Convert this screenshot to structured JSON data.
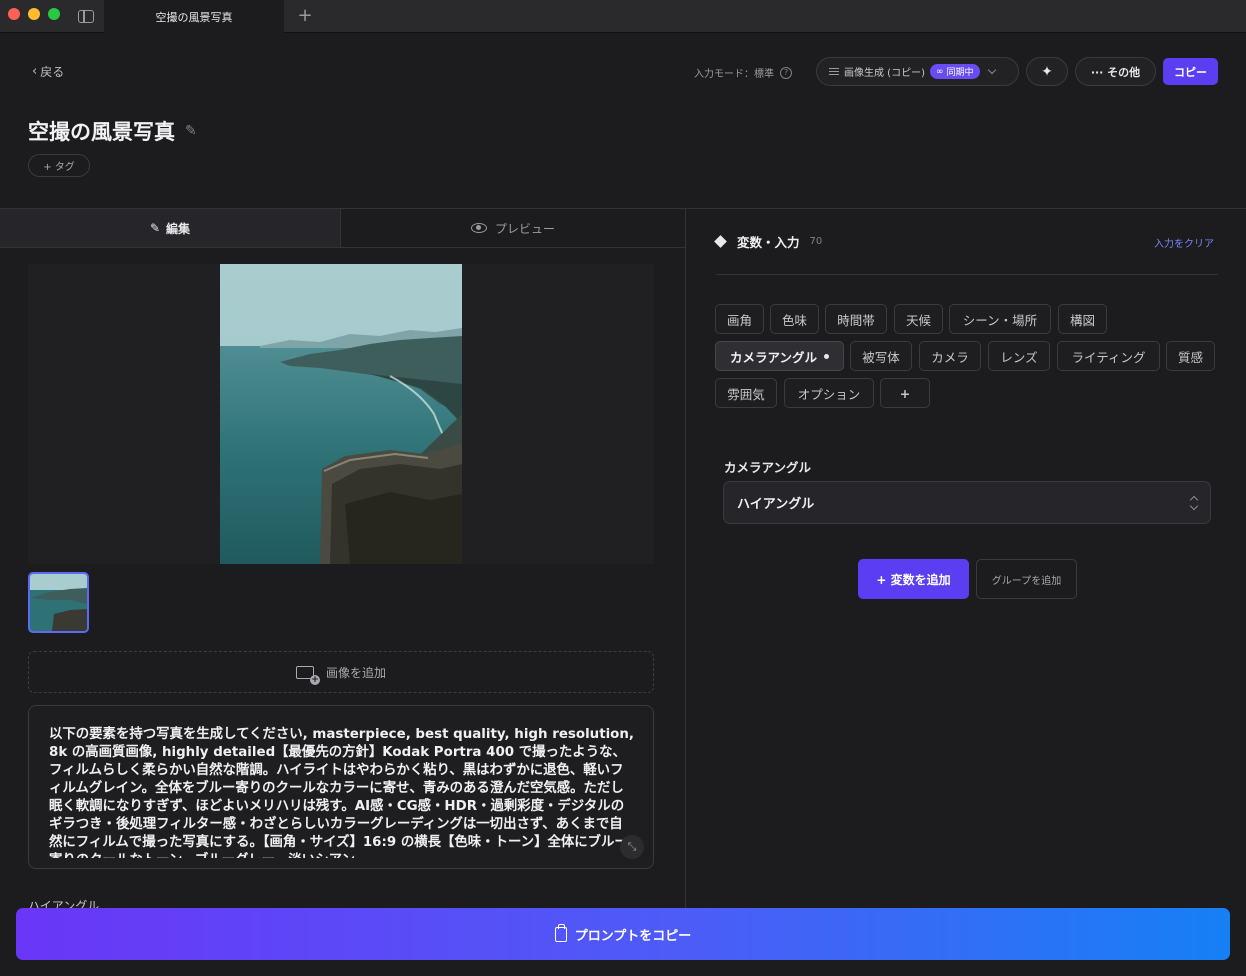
{
  "window": {
    "tab_title": "空撮の風景写真",
    "new_tab_label": "+"
  },
  "header": {
    "back_label": "戻る",
    "input_mode_label": "入力モード：標準",
    "help_symbol": "?",
    "mode_select_label": "画像生成 (コピー)",
    "sync_badge": "同期中",
    "more_label": "··· その他",
    "copy_label": "コピー",
    "page_title": "空撮の風景写真",
    "tag_label": "+ タグ"
  },
  "left_panel": {
    "tabs": [
      {
        "label": "編集"
      },
      {
        "label": "プレビュー"
      }
    ],
    "add_image_label": "画像を追加",
    "prompt_text": "以下の要素を持つ写真を生成してください, masterpiece, best quality, high resolution, 8k の高画質画像, highly detailed【最優先の方針】Kodak Portra 400 で撮ったような、フィルムらしく柔らかい自然な階調。ハイライトはやわらかく粘り、黒はわずかに退色、軽いフィルムグレイン。全体をブルー寄りのクールなカラーに寄せ、青みのある澄んだ空気感。ただし眠く軟調になりすぎず、ほどよいメリハリは残す。AI感・CG感・HDR・過剰彩度・デジタルのギラつき・後処理フィルター感・わざとらしいカラーグレーディングは一切出さず、あくまで自然にフィルムで撮った写真にする。【画角・サイズ】16:9 の横長【色味・トーン】全体にブルー寄りのクールなトーン、ブルーグレー、淡いシアン",
    "below_label": "ハイアングル"
  },
  "right_panel": {
    "title": "変数・入力",
    "count": "70",
    "clear_label": "入力をクリア",
    "chips": [
      {
        "label": "画角"
      },
      {
        "label": "色味"
      },
      {
        "label": "時間帯"
      },
      {
        "label": "天候"
      },
      {
        "label": "シーン・場所"
      },
      {
        "label": "構図"
      },
      {
        "label": "カメラアングル"
      },
      {
        "label": "被写体"
      },
      {
        "label": "カメラ"
      },
      {
        "label": "レンズ"
      },
      {
        "label": "ライティング"
      },
      {
        "label": "質感"
      },
      {
        "label": "雰囲気"
      },
      {
        "label": "オプション"
      },
      {
        "label": "+"
      }
    ],
    "field_label": "カメラアングル",
    "field_value": "ハイアングル",
    "add_variable_label": "+ 変数を追加",
    "add_group_label": "グループを追加"
  },
  "footer": {
    "copy_prompt_label": "プロンプトをコピー"
  },
  "colors": {
    "accent": "#5b3df2",
    "link": "#7b84f5",
    "background": "#1c1c1f"
  }
}
